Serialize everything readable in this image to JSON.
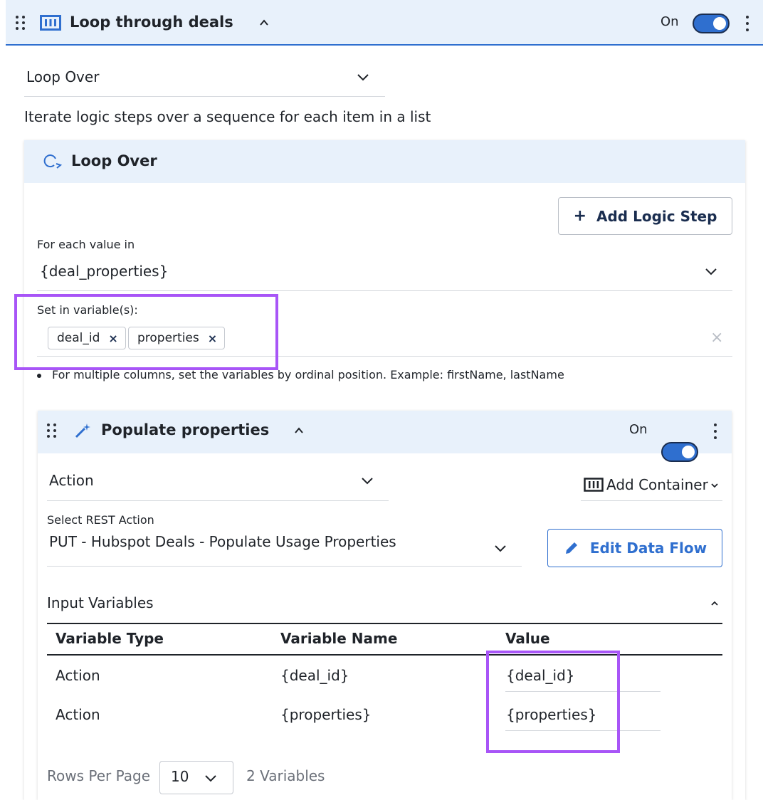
{
  "step": {
    "title": "Loop through deals",
    "toggle_label": "On",
    "step_type": "Loop Over",
    "description": "Iterate logic steps over a sequence for each item in a list"
  },
  "loop_card": {
    "header": "Loop Over",
    "add_logic_step_label": "Add Logic Step",
    "for_each_label": "For each value in",
    "for_each_value": "{deal_properties}",
    "set_variables_label": "Set in variable(s):",
    "variables": [
      "deal_id",
      "properties"
    ],
    "hint": "For multiple columns, set the variables by ordinal position. Example: firstName, lastName"
  },
  "inner_step": {
    "title": "Populate properties",
    "toggle_label": "On",
    "step_type": "Action",
    "add_container_label": "Add Container",
    "select_rest_label": "Select REST Action",
    "rest_action_value": "PUT - Hubspot Deals - Populate Usage Properties",
    "edit_data_flow_label": "Edit Data Flow",
    "input_variables_label": "Input Variables",
    "table": {
      "headers": [
        "Variable Type",
        "Variable Name",
        "Value"
      ],
      "rows": [
        [
          "Action",
          "{deal_id}",
          "{deal_id}"
        ],
        [
          "Action",
          "{properties}",
          "{properties}"
        ]
      ]
    },
    "rows_per_page_label": "Rows Per Page",
    "rows_per_page_value": "10",
    "variables_count": "2 Variables"
  },
  "colors": {
    "accent": "#2f6fcf",
    "header_bg": "#e8f1fb",
    "highlight": "#a855f7"
  }
}
